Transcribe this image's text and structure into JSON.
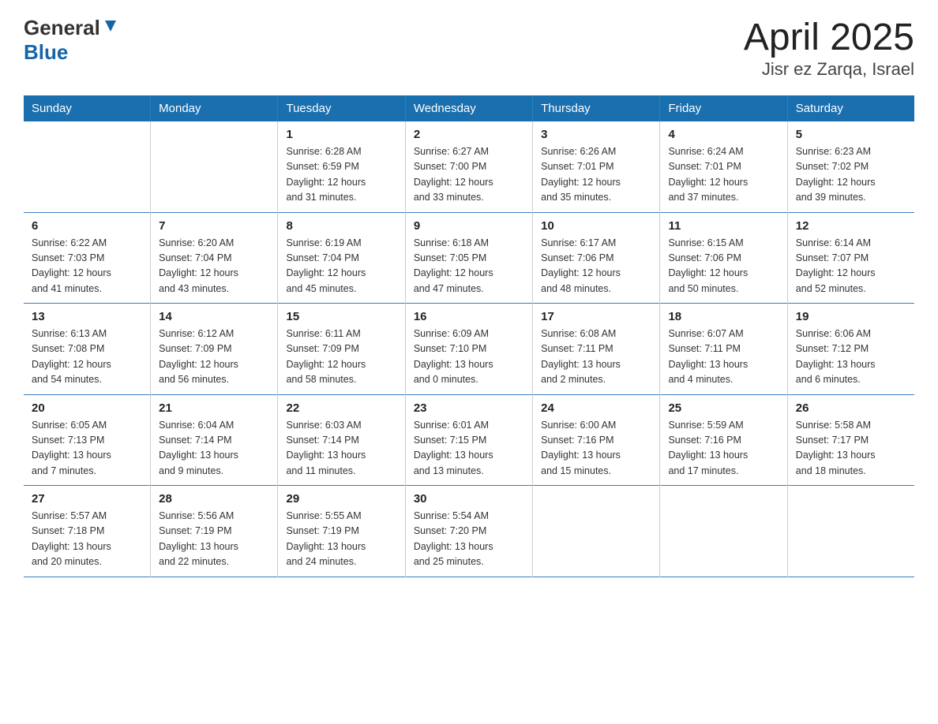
{
  "header": {
    "logo_general": "General",
    "logo_blue": "Blue",
    "title": "April 2025",
    "subtitle": "Jisr ez Zarqa, Israel"
  },
  "days_of_week": [
    "Sunday",
    "Monday",
    "Tuesday",
    "Wednesday",
    "Thursday",
    "Friday",
    "Saturday"
  ],
  "weeks": [
    [
      {
        "day": "",
        "info": ""
      },
      {
        "day": "",
        "info": ""
      },
      {
        "day": "1",
        "info": "Sunrise: 6:28 AM\nSunset: 6:59 PM\nDaylight: 12 hours\nand 31 minutes."
      },
      {
        "day": "2",
        "info": "Sunrise: 6:27 AM\nSunset: 7:00 PM\nDaylight: 12 hours\nand 33 minutes."
      },
      {
        "day": "3",
        "info": "Sunrise: 6:26 AM\nSunset: 7:01 PM\nDaylight: 12 hours\nand 35 minutes."
      },
      {
        "day": "4",
        "info": "Sunrise: 6:24 AM\nSunset: 7:01 PM\nDaylight: 12 hours\nand 37 minutes."
      },
      {
        "day": "5",
        "info": "Sunrise: 6:23 AM\nSunset: 7:02 PM\nDaylight: 12 hours\nand 39 minutes."
      }
    ],
    [
      {
        "day": "6",
        "info": "Sunrise: 6:22 AM\nSunset: 7:03 PM\nDaylight: 12 hours\nand 41 minutes."
      },
      {
        "day": "7",
        "info": "Sunrise: 6:20 AM\nSunset: 7:04 PM\nDaylight: 12 hours\nand 43 minutes."
      },
      {
        "day": "8",
        "info": "Sunrise: 6:19 AM\nSunset: 7:04 PM\nDaylight: 12 hours\nand 45 minutes."
      },
      {
        "day": "9",
        "info": "Sunrise: 6:18 AM\nSunset: 7:05 PM\nDaylight: 12 hours\nand 47 minutes."
      },
      {
        "day": "10",
        "info": "Sunrise: 6:17 AM\nSunset: 7:06 PM\nDaylight: 12 hours\nand 48 minutes."
      },
      {
        "day": "11",
        "info": "Sunrise: 6:15 AM\nSunset: 7:06 PM\nDaylight: 12 hours\nand 50 minutes."
      },
      {
        "day": "12",
        "info": "Sunrise: 6:14 AM\nSunset: 7:07 PM\nDaylight: 12 hours\nand 52 minutes."
      }
    ],
    [
      {
        "day": "13",
        "info": "Sunrise: 6:13 AM\nSunset: 7:08 PM\nDaylight: 12 hours\nand 54 minutes."
      },
      {
        "day": "14",
        "info": "Sunrise: 6:12 AM\nSunset: 7:09 PM\nDaylight: 12 hours\nand 56 minutes."
      },
      {
        "day": "15",
        "info": "Sunrise: 6:11 AM\nSunset: 7:09 PM\nDaylight: 12 hours\nand 58 minutes."
      },
      {
        "day": "16",
        "info": "Sunrise: 6:09 AM\nSunset: 7:10 PM\nDaylight: 13 hours\nand 0 minutes."
      },
      {
        "day": "17",
        "info": "Sunrise: 6:08 AM\nSunset: 7:11 PM\nDaylight: 13 hours\nand 2 minutes."
      },
      {
        "day": "18",
        "info": "Sunrise: 6:07 AM\nSunset: 7:11 PM\nDaylight: 13 hours\nand 4 minutes."
      },
      {
        "day": "19",
        "info": "Sunrise: 6:06 AM\nSunset: 7:12 PM\nDaylight: 13 hours\nand 6 minutes."
      }
    ],
    [
      {
        "day": "20",
        "info": "Sunrise: 6:05 AM\nSunset: 7:13 PM\nDaylight: 13 hours\nand 7 minutes."
      },
      {
        "day": "21",
        "info": "Sunrise: 6:04 AM\nSunset: 7:14 PM\nDaylight: 13 hours\nand 9 minutes."
      },
      {
        "day": "22",
        "info": "Sunrise: 6:03 AM\nSunset: 7:14 PM\nDaylight: 13 hours\nand 11 minutes."
      },
      {
        "day": "23",
        "info": "Sunrise: 6:01 AM\nSunset: 7:15 PM\nDaylight: 13 hours\nand 13 minutes."
      },
      {
        "day": "24",
        "info": "Sunrise: 6:00 AM\nSunset: 7:16 PM\nDaylight: 13 hours\nand 15 minutes."
      },
      {
        "day": "25",
        "info": "Sunrise: 5:59 AM\nSunset: 7:16 PM\nDaylight: 13 hours\nand 17 minutes."
      },
      {
        "day": "26",
        "info": "Sunrise: 5:58 AM\nSunset: 7:17 PM\nDaylight: 13 hours\nand 18 minutes."
      }
    ],
    [
      {
        "day": "27",
        "info": "Sunrise: 5:57 AM\nSunset: 7:18 PM\nDaylight: 13 hours\nand 20 minutes."
      },
      {
        "day": "28",
        "info": "Sunrise: 5:56 AM\nSunset: 7:19 PM\nDaylight: 13 hours\nand 22 minutes."
      },
      {
        "day": "29",
        "info": "Sunrise: 5:55 AM\nSunset: 7:19 PM\nDaylight: 13 hours\nand 24 minutes."
      },
      {
        "day": "30",
        "info": "Sunrise: 5:54 AM\nSunset: 7:20 PM\nDaylight: 13 hours\nand 25 minutes."
      },
      {
        "day": "",
        "info": ""
      },
      {
        "day": "",
        "info": ""
      },
      {
        "day": "",
        "info": ""
      }
    ]
  ]
}
